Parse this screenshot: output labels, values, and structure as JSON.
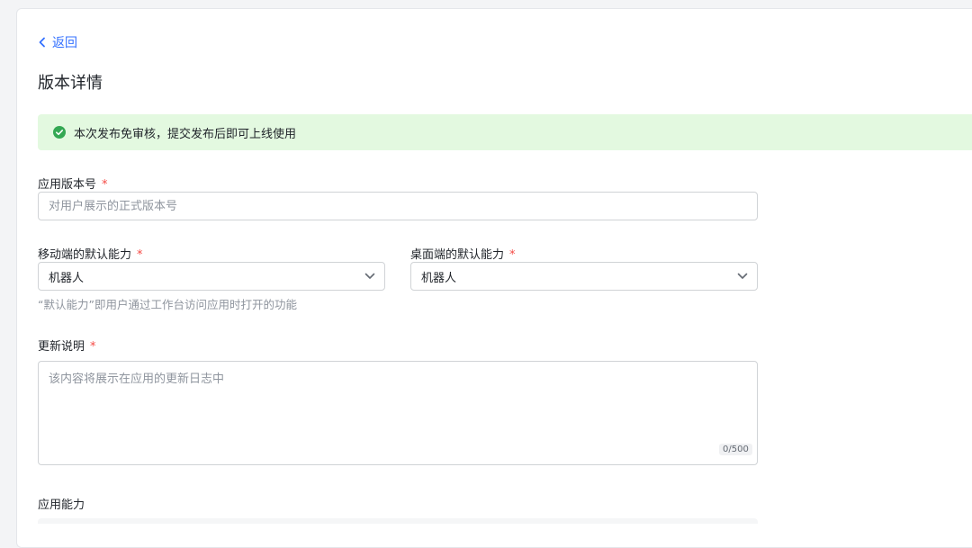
{
  "nav": {
    "back_label": "返回"
  },
  "page": {
    "title": "版本详情"
  },
  "alert": {
    "text": "本次发布免审核，提交发布后即可上线使用",
    "color": "#e3f9e0",
    "icon": "check-circle-icon"
  },
  "form": {
    "version": {
      "label": "应用版本号",
      "required_mark": "*",
      "placeholder": "对用户展示的正式版本号",
      "value": ""
    },
    "mobile_default": {
      "label": "移动端的默认能力",
      "required_mark": "*",
      "value": "机器人"
    },
    "desktop_default": {
      "label": "桌面端的默认能力",
      "required_mark": "*",
      "value": "机器人"
    },
    "default_hint": "“默认能力”即用户通过工作台访问应用时打开的功能",
    "changelog": {
      "label": "更新说明",
      "required_mark": "*",
      "placeholder": "该内容将展示在应用的更新日志中",
      "value": "",
      "counter": "0/500"
    },
    "capabilities": {
      "label": "应用能力"
    }
  },
  "colors": {
    "accent": "#3370ff",
    "required": "#f54a45",
    "success": "#34c759"
  }
}
